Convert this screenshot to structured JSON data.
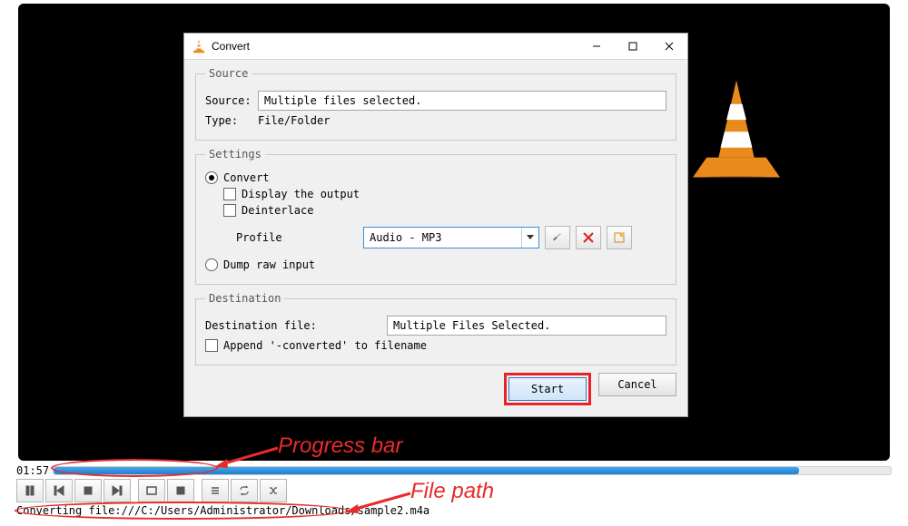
{
  "window": {
    "title": "Convert"
  },
  "source": {
    "legend": "Source",
    "source_label": "Source:",
    "source_value": "Multiple files selected.",
    "type_label": "Type:",
    "type_value": "File/Folder"
  },
  "settings": {
    "legend": "Settings",
    "convert_label": "Convert",
    "display_output_label": "Display the output",
    "deinterlace_label": "Deinterlace",
    "profile_label": "Profile",
    "profile_value": "Audio - MP3",
    "dump_label": "Dump raw input"
  },
  "destination": {
    "legend": "Destination",
    "file_label": "Destination file:",
    "file_value": "Multiple Files Selected.",
    "append_label": "Append '-converted' to filename"
  },
  "buttons": {
    "start": "Start",
    "cancel": "Cancel"
  },
  "player": {
    "time": "01:57",
    "progress_percent": 89
  },
  "status": {
    "text": "Converting file:///C:/Users/Administrator/Downloads/sample2.m4a"
  },
  "annotations": {
    "progress_bar": "Progress bar",
    "file_path": "File path"
  }
}
